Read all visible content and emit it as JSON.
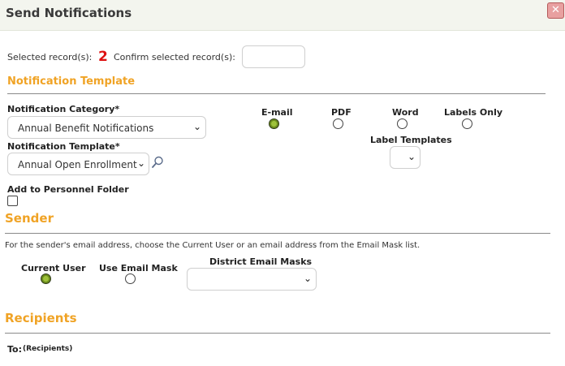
{
  "dialog": {
    "title": "Send Notifications",
    "close_label": "✕"
  },
  "selection": {
    "selected_label": "Selected record(s):",
    "count": "2",
    "confirm_label": "Confirm selected record(s):",
    "confirm_value": ""
  },
  "notification_template": {
    "heading": "Notification Template",
    "category_label": "Notification Category*",
    "category_value": "Annual Benefit Notifications",
    "template_label": "Notification Template*",
    "template_value": "Annual Open Enrollment",
    "personnel_label": "Add to Personnel Folder",
    "personnel_checked": false,
    "formats": [
      {
        "label": "E-mail",
        "selected": true
      },
      {
        "label": "PDF",
        "selected": false
      },
      {
        "label": "Word",
        "selected": false
      },
      {
        "label": "Labels Only",
        "selected": false
      }
    ],
    "label_templates_label": "Label Templates",
    "label_templates_value": ""
  },
  "sender": {
    "heading": "Sender",
    "description": "For the sender's email address, choose the Current User or an email address from the Email Mask list.",
    "options": [
      {
        "label": "Current User",
        "selected": true
      },
      {
        "label": "Use Email Mask",
        "selected": false
      }
    ],
    "masks_label": "District Email Masks",
    "masks_value": ""
  },
  "recipients": {
    "heading": "Recipients",
    "to_label": "To:",
    "to_value": "(Recipients)"
  },
  "colors": {
    "accent": "#f0a325",
    "count": "#dd1111",
    "radio_selected": "#6c8c1c",
    "titlebar": "#f3f5ee"
  },
  "icons": [
    "close-icon",
    "search-icon",
    "chevron-down-icon"
  ]
}
